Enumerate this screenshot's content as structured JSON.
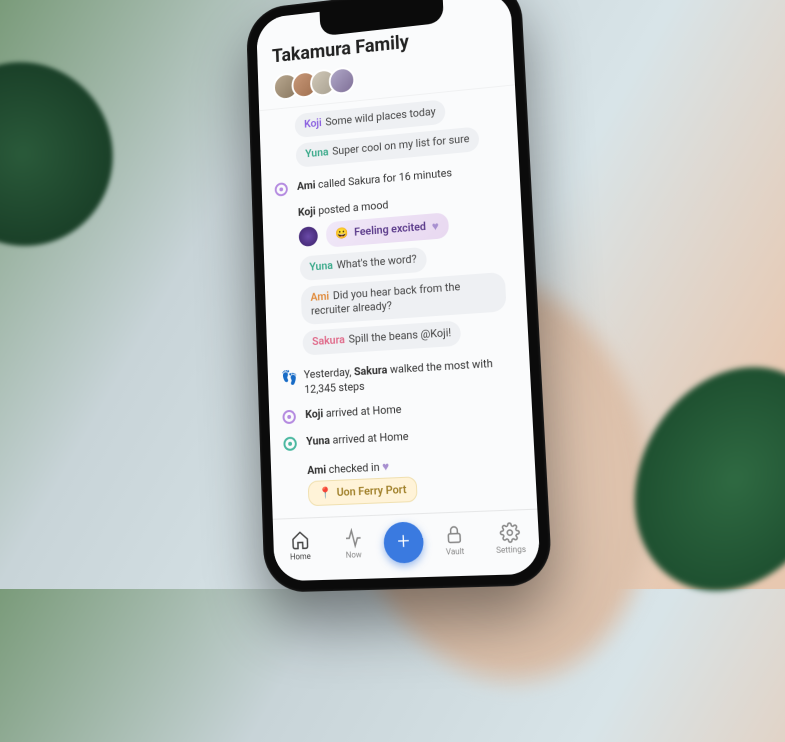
{
  "header": {
    "title": "Takamura Family"
  },
  "colors": {
    "koji": "#8a5fe0",
    "yuna": "#3aa98a",
    "ami": "#e08a3a",
    "sakura": "#e06a8a",
    "fab": "#3a7ae0"
  },
  "messages": {
    "m1": {
      "name": "Koji",
      "text": "Some wild places today"
    },
    "m2": {
      "name": "Yuna",
      "text": "Super cool on my list for sure"
    },
    "m3": {
      "name": "Yuna",
      "text": "What's the word?"
    },
    "m4": {
      "name": "Ami",
      "text": "Did you hear back from the recruiter already?"
    },
    "m5": {
      "name": "Sakura",
      "text": "Spill the beans @Koji!"
    }
  },
  "events": {
    "call": {
      "caller": "Ami",
      "callee": "Sakura",
      "duration": "16 minutes",
      "prefix_text": " called ",
      "suffix_text": " for "
    },
    "mood": {
      "poster": "Koji",
      "action": " posted a mood",
      "emoji": "😀",
      "label": "Feeling excited"
    },
    "steps": {
      "prefix": "Yesterday, ",
      "who": "Sakura",
      "rest": " walked the most with 12,345 steps"
    },
    "arrive1": {
      "who": "Koji",
      "rest": " arrived at Home"
    },
    "arrive2": {
      "who": "Yuna",
      "rest": " arrived at Home"
    },
    "checkin": {
      "who": "Ami",
      "rest": " checked in",
      "place": "Uon Ferry Port",
      "pin": "📍"
    }
  },
  "tabs": {
    "home": "Home",
    "now": "Now",
    "vault": "Vault",
    "settings": "Settings"
  }
}
